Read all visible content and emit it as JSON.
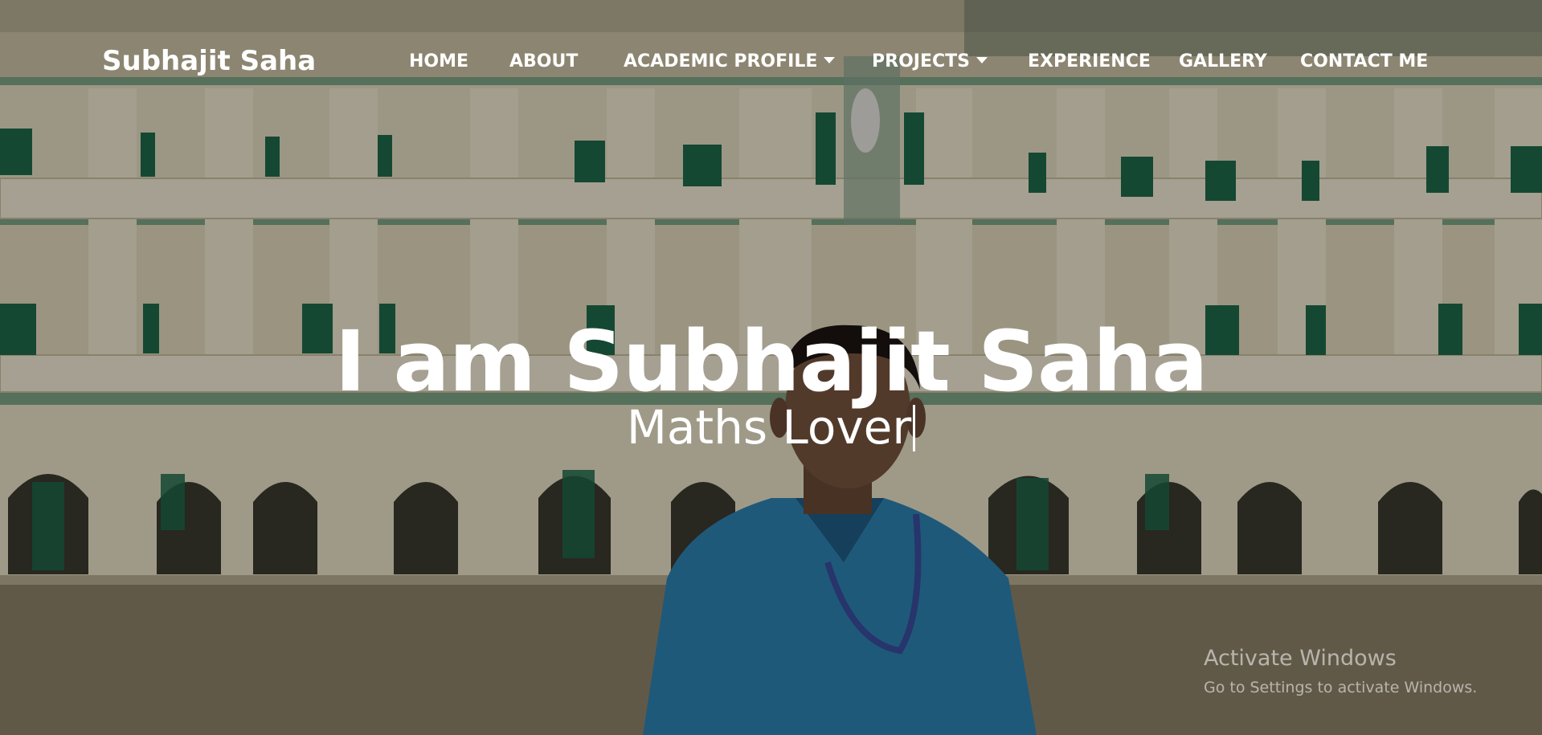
{
  "navbar": {
    "brand": "Subhajit Saha",
    "links": [
      {
        "label": "HOME"
      },
      {
        "label": "ABOUT"
      },
      {
        "label": "ACADEMIC PROFILE",
        "dropdown": true
      },
      {
        "label": "PROJECTS",
        "dropdown": true
      },
      {
        "label": "EXPERIENCE"
      },
      {
        "label": "GALLERY"
      },
      {
        "label": "CONTACT ME"
      }
    ]
  },
  "hero": {
    "title": "I am Subhajit Saha",
    "typed_text": "Maths Lover",
    "background_image": "college-building-portrait"
  },
  "watermark": {
    "title": "Activate Windows",
    "subtitle": "Go to Settings to activate Windows."
  },
  "colors": {
    "text": "#ffffff",
    "building": "#e4dcc0",
    "trim": "#6f9b7a",
    "shirt": "#2f84b4"
  }
}
